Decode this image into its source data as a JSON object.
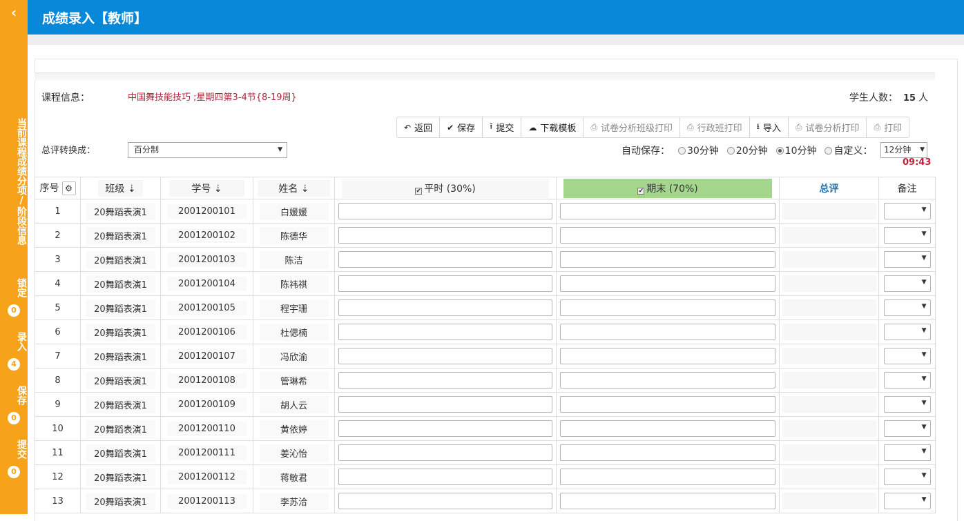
{
  "sidebar": {
    "back_icon": "chevron-left-icon",
    "info_text": "当前课程成绩分项/阶段信息",
    "stats": [
      {
        "label": "锁定",
        "count": "0"
      },
      {
        "label": "录入",
        "count": "4"
      },
      {
        "label": "保存",
        "count": "0"
      },
      {
        "label": "提交",
        "count": "0"
      }
    ]
  },
  "header": {
    "title": "成绩录入【教师】"
  },
  "course": {
    "label": "课程信息：",
    "value": "中国舞技能技巧 ;星期四第3-4节{8-19周}",
    "student_count_label": "学生人数：",
    "student_count": "15",
    "student_count_unit": "人"
  },
  "toolbar": [
    {
      "name": "back-button",
      "icon": "↶",
      "label": "返回",
      "dim": false
    },
    {
      "name": "save-button",
      "icon": "✔",
      "label": "保存",
      "dim": false
    },
    {
      "name": "submit-button",
      "icon": "⭱",
      "label": "提交",
      "dim": false
    },
    {
      "name": "download-template-button",
      "icon": "☁",
      "label": "下载模板",
      "dim": false
    },
    {
      "name": "paper-analysis-class-print-button",
      "icon": "⎙",
      "label": "试卷分析班级打印",
      "dim": true
    },
    {
      "name": "admin-class-print-button",
      "icon": "⎙",
      "label": "行政班打印",
      "dim": true
    },
    {
      "name": "import-button",
      "icon": "⭳",
      "label": "导入",
      "dim": false
    },
    {
      "name": "paper-analysis-print-button",
      "icon": "⎙",
      "label": "试卷分析打印",
      "dim": true
    },
    {
      "name": "print-button",
      "icon": "⎙",
      "label": "打印",
      "dim": true
    }
  ],
  "conversion": {
    "label": "总评转换成：",
    "value": "百分制"
  },
  "autosave": {
    "label": "自动保存：",
    "options": [
      "30分钟",
      "20分钟",
      "10分钟",
      "自定义："
    ],
    "selected_index": 2,
    "custom_value": "12分钟",
    "countdown": "09:43"
  },
  "table": {
    "headers": {
      "seq": "序号",
      "class": "班级",
      "student_id": "学号",
      "name": "姓名",
      "regular": "平时 (30%)",
      "final": "期末 (70%)",
      "total": "总评",
      "remark": "备注"
    },
    "rows": [
      {
        "seq": "1",
        "class": "20舞蹈表演1",
        "id": "2001200101",
        "name": "白媛媛"
      },
      {
        "seq": "2",
        "class": "20舞蹈表演1",
        "id": "2001200102",
        "name": "陈德华"
      },
      {
        "seq": "3",
        "class": "20舞蹈表演1",
        "id": "2001200103",
        "name": "陈洁"
      },
      {
        "seq": "4",
        "class": "20舞蹈表演1",
        "id": "2001200104",
        "name": "陈祎祺"
      },
      {
        "seq": "5",
        "class": "20舞蹈表演1",
        "id": "2001200105",
        "name": "程宇珊"
      },
      {
        "seq": "6",
        "class": "20舞蹈表演1",
        "id": "2001200106",
        "name": "杜偲楠"
      },
      {
        "seq": "7",
        "class": "20舞蹈表演1",
        "id": "2001200107",
        "name": "冯欣渝"
      },
      {
        "seq": "8",
        "class": "20舞蹈表演1",
        "id": "2001200108",
        "name": "管琳希"
      },
      {
        "seq": "9",
        "class": "20舞蹈表演1",
        "id": "2001200109",
        "name": "胡人云"
      },
      {
        "seq": "10",
        "class": "20舞蹈表演1",
        "id": "2001200110",
        "name": "黄依婷"
      },
      {
        "seq": "11",
        "class": "20舞蹈表演1",
        "id": "2001200111",
        "name": "姜沁怡"
      },
      {
        "seq": "12",
        "class": "20舞蹈表演1",
        "id": "2001200112",
        "name": "蒋敏君"
      },
      {
        "seq": "13",
        "class": "20舞蹈表演1",
        "id": "2001200113",
        "name": "李苏洽"
      }
    ]
  }
}
